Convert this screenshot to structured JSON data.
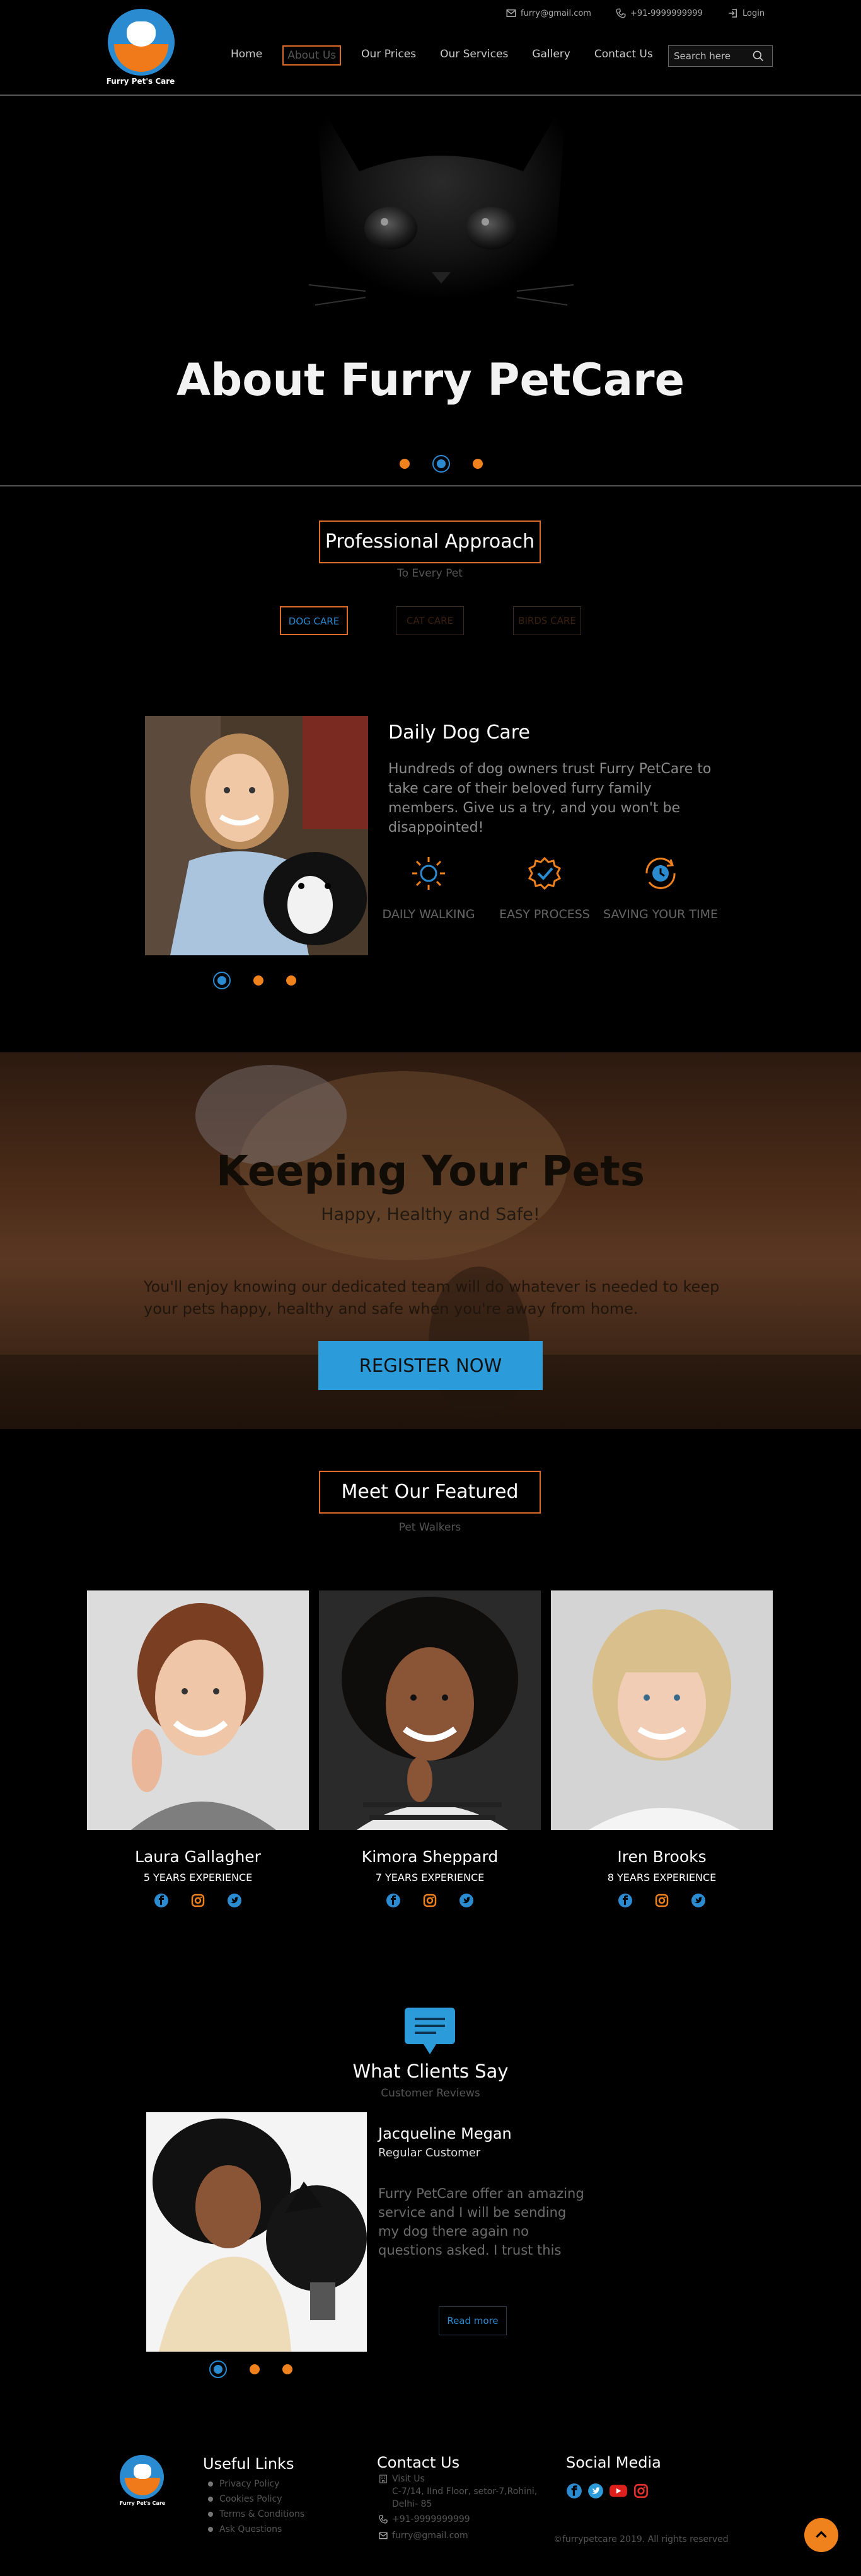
{
  "header": {
    "logo_text": "Furry Pet's Care",
    "email": "furry@gmail.com",
    "phone": "+91-9999999999",
    "login": "Login",
    "nav": [
      "Home",
      "About Us",
      "Our Prices",
      "Our Services",
      "Gallery",
      "Contact Us"
    ],
    "active_nav": "About Us",
    "search_placeholder": "Search here"
  },
  "hero": {
    "title": "About Furry PetCare",
    "slide_count": 3,
    "active_slide": 2
  },
  "approach": {
    "title": "Professional Approach",
    "subtitle": "To Every Pet",
    "tabs": [
      "DOG CARE",
      "CAT CARE",
      "BIRDS CARE"
    ],
    "active_tab": "DOG CARE",
    "card_title": "Daily Dog Care",
    "card_text": "Hundreds of dog owners trust Furry PetCare to take care of their beloved furry family members. Give us a try, and you won't be disappointed!",
    "features": [
      {
        "label": "DAILY WALKING",
        "icon": "sun-icon"
      },
      {
        "label": "EASY PROCESS",
        "icon": "badge-check-icon"
      },
      {
        "label": "SAVING YOUR TIME",
        "icon": "clock-refresh-icon"
      }
    ],
    "slide_count": 3,
    "active_slide": 1
  },
  "keeping": {
    "title": "Keeping Your Pets",
    "subtitle": "Happy, Healthy and Safe!",
    "text": "You'll enjoy knowing our dedicated team will do whatever is needed to keep your pets happy, healthy and safe when you're away from home.",
    "button": "REGISTER NOW"
  },
  "walkers": {
    "title": "Meet Our Featured",
    "subtitle": "Pet Walkers",
    "people": [
      {
        "name": "Laura Gallagher",
        "experience": "5 YEARS EXPERIENCE"
      },
      {
        "name": "Kimora Sheppard",
        "experience": "7 YEARS EXPERIENCE"
      },
      {
        "name": "Iren Brooks",
        "experience": "8 YEARS EXPERIENCE"
      }
    ]
  },
  "testimonials": {
    "title": "What Clients Say",
    "subtitle": "Customer Reviews",
    "client_name": "Jacqueline Megan",
    "client_role": "Regular Customer",
    "client_text": "Furry PetCare offer an amazing service and I will be sending my dog there again no questions asked. I trust this team and I",
    "read_more": "Read more",
    "slide_count": 3,
    "active_slide": 1
  },
  "footer": {
    "useful_links_title": "Useful Links",
    "useful_links": [
      "Privacy Policy",
      "Cookies Policy",
      "Terms & Conditions",
      "Ask Questions"
    ],
    "contact_title": "Contact Us",
    "visit_us": "Visit Us",
    "address_line1": "C-7/14, IInd Floor, setor-7,Rohini,",
    "address_line2": "Delhi- 85",
    "phone": "+91-9999999999",
    "email": "furry@gmail.com",
    "social_title": "Social Media",
    "copyright": "©furrypetcare 2019. All rights reserved"
  },
  "colors": {
    "accent_orange": "#f0821e",
    "accent_blue": "#2b8bd1",
    "background": "#000000"
  }
}
